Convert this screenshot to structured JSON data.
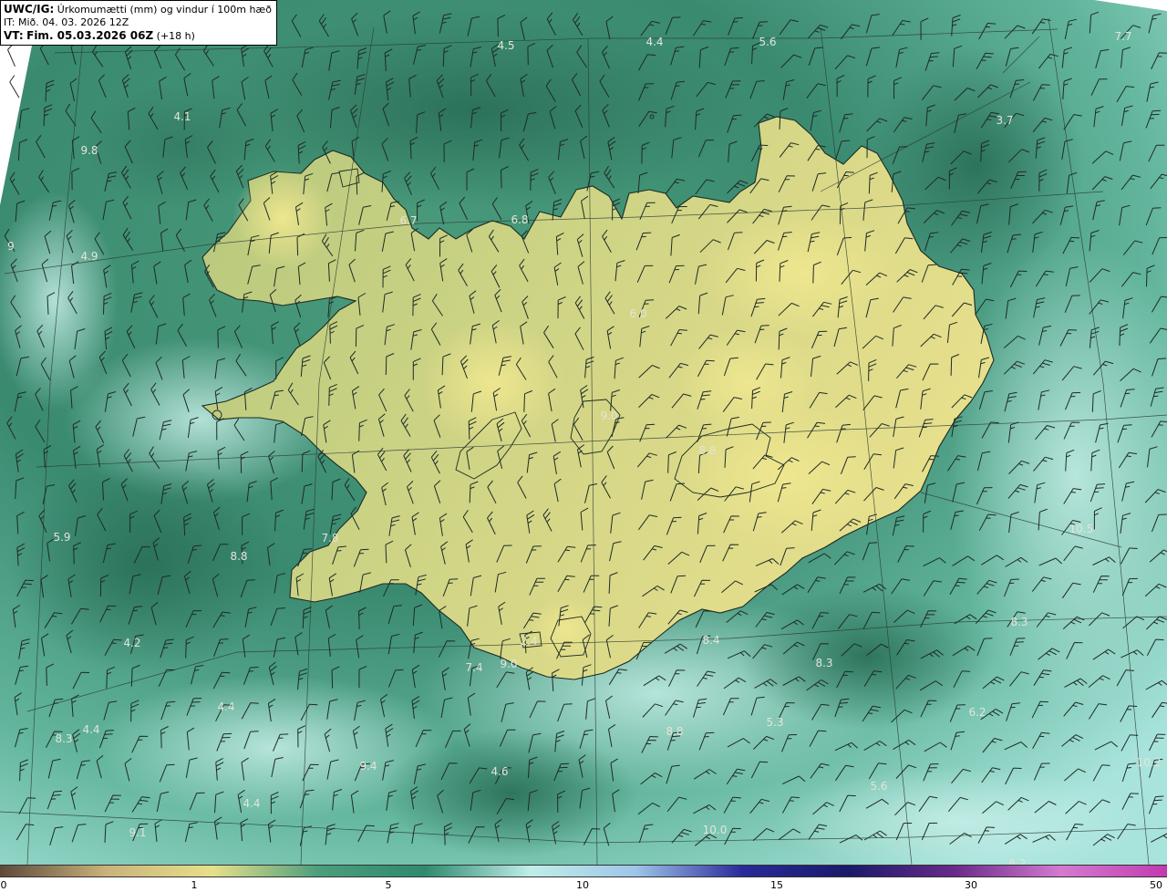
{
  "title": {
    "product": "UWC/IG:",
    "description": "Úrkomumætti (mm) og vindur í 100m hæð",
    "it_line": "IT: Mið. 04. 03. 2026 12Z",
    "vt_prefix": "VT:",
    "vt_bold": "Fim. 05.03.2026 06Z",
    "vt_offset": "(+18 h)"
  },
  "colors": {
    "ocean_dark": "#2f7a62",
    "ocean_mid": "#3f9178",
    "ocean_light": "#9fe0d6",
    "land_low": "#6fa86a",
    "land_high": "#e6e08a",
    "coastline": "#1a2a22",
    "barb": "#1e2b25",
    "label_text": "#e4e4d8"
  },
  "colorbar": {
    "ticks": [
      "0",
      "1",
      "5",
      "10",
      "15",
      "30",
      "50"
    ],
    "stops": [
      "#5d4a3a",
      "#c9b27a",
      "#e7e08a",
      "#4c9e7c",
      "#2f8a6f",
      "#bfeee8",
      "#9ec4e8",
      "#2a2a9a",
      "#1a1a6a",
      "#6a2a8a",
      "#d47ad0",
      "#c23ab0"
    ]
  },
  "map_labels": [
    {
      "text": "4.5"
    },
    {
      "text": "4.4"
    },
    {
      "text": "5.6"
    },
    {
      "text": "3.7"
    },
    {
      "text": "4.1"
    },
    {
      "text": "9.8"
    },
    {
      "text": "6.7"
    },
    {
      "text": "6.8"
    },
    {
      "text": "4.9"
    },
    {
      "text": "9"
    },
    {
      "text": "6.0"
    },
    {
      "text": "5.9"
    },
    {
      "text": "7.8"
    },
    {
      "text": "8.8"
    },
    {
      "text": "8.8"
    },
    {
      "text": "10.5"
    },
    {
      "text": "4.2"
    },
    {
      "text": "4.4"
    },
    {
      "text": "4.4"
    },
    {
      "text": "8.3"
    },
    {
      "text": "9.4"
    },
    {
      "text": "4.6"
    },
    {
      "text": "4.4"
    },
    {
      "text": "5.3"
    },
    {
      "text": "6.2"
    },
    {
      "text": "5.6"
    },
    {
      "text": "8.3"
    },
    {
      "text": "9.1"
    },
    {
      "text": "10.0"
    },
    {
      "text": "6.2"
    },
    {
      "text": "10.2"
    },
    {
      "text": "8.8"
    },
    {
      "text": "8.4"
    },
    {
      "text": "7.7"
    },
    {
      "text": "8.3"
    },
    {
      "text": "9.0"
    },
    {
      "text": "2.4"
    },
    {
      "text": "7.4"
    },
    {
      "text": "9.0"
    }
  ]
}
